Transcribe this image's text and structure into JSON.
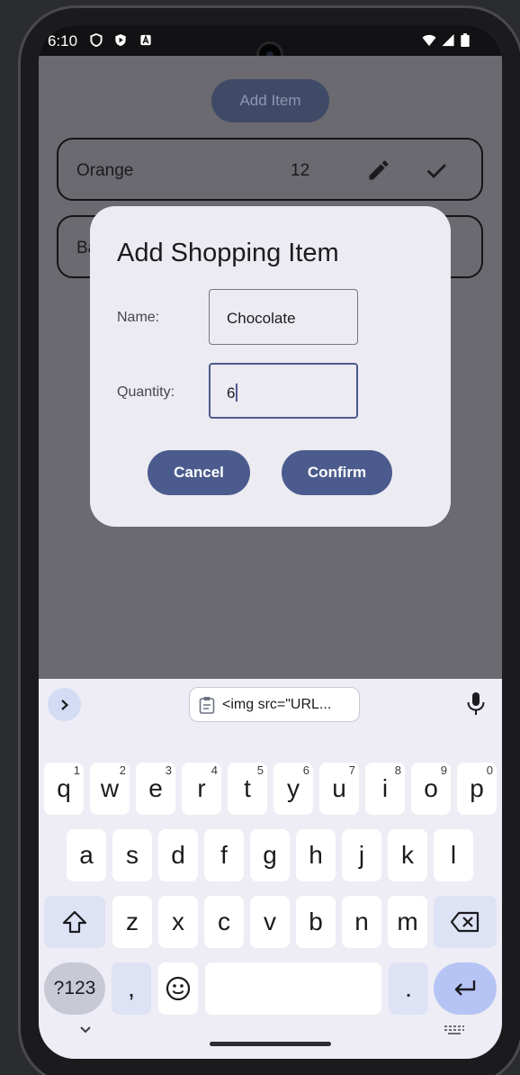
{
  "status_bar": {
    "time": "6:10",
    "left_icons": [
      "shield-icon",
      "play-protect-icon",
      "a-badge-icon"
    ],
    "right_icons": [
      "wifi-icon",
      "signal-icon",
      "battery-icon"
    ]
  },
  "app": {
    "add_item_label": "Add Item",
    "items": [
      {
        "name": "Orange",
        "quantity": "12"
      },
      {
        "name": "Ba",
        "quantity": ""
      }
    ]
  },
  "dialog": {
    "title": "Add Shopping Item",
    "name_label": "Name:",
    "name_value": "Chocolate",
    "quantity_label": "Quantity:",
    "quantity_value": "6",
    "cancel_label": "Cancel",
    "confirm_label": "Confirm"
  },
  "keyboard": {
    "clipboard_suggestion": "<img src=\"URL...",
    "row1": [
      {
        "k": "q",
        "h": "1"
      },
      {
        "k": "w",
        "h": "2"
      },
      {
        "k": "e",
        "h": "3"
      },
      {
        "k": "r",
        "h": "4"
      },
      {
        "k": "t",
        "h": "5"
      },
      {
        "k": "y",
        "h": "6"
      },
      {
        "k": "u",
        "h": "7"
      },
      {
        "k": "i",
        "h": "8"
      },
      {
        "k": "o",
        "h": "9"
      },
      {
        "k": "p",
        "h": "0"
      }
    ],
    "row2": [
      "a",
      "s",
      "d",
      "f",
      "g",
      "h",
      "j",
      "k",
      "l"
    ],
    "row3": [
      "z",
      "x",
      "c",
      "v",
      "b",
      "n",
      "m"
    ],
    "sym_label": "?123",
    "comma_label": ",",
    "period_label": "."
  },
  "colors": {
    "accent": "#4c5b8d",
    "scrim_background": "#6b6a70",
    "dialog_surface": "#ecebf2"
  }
}
